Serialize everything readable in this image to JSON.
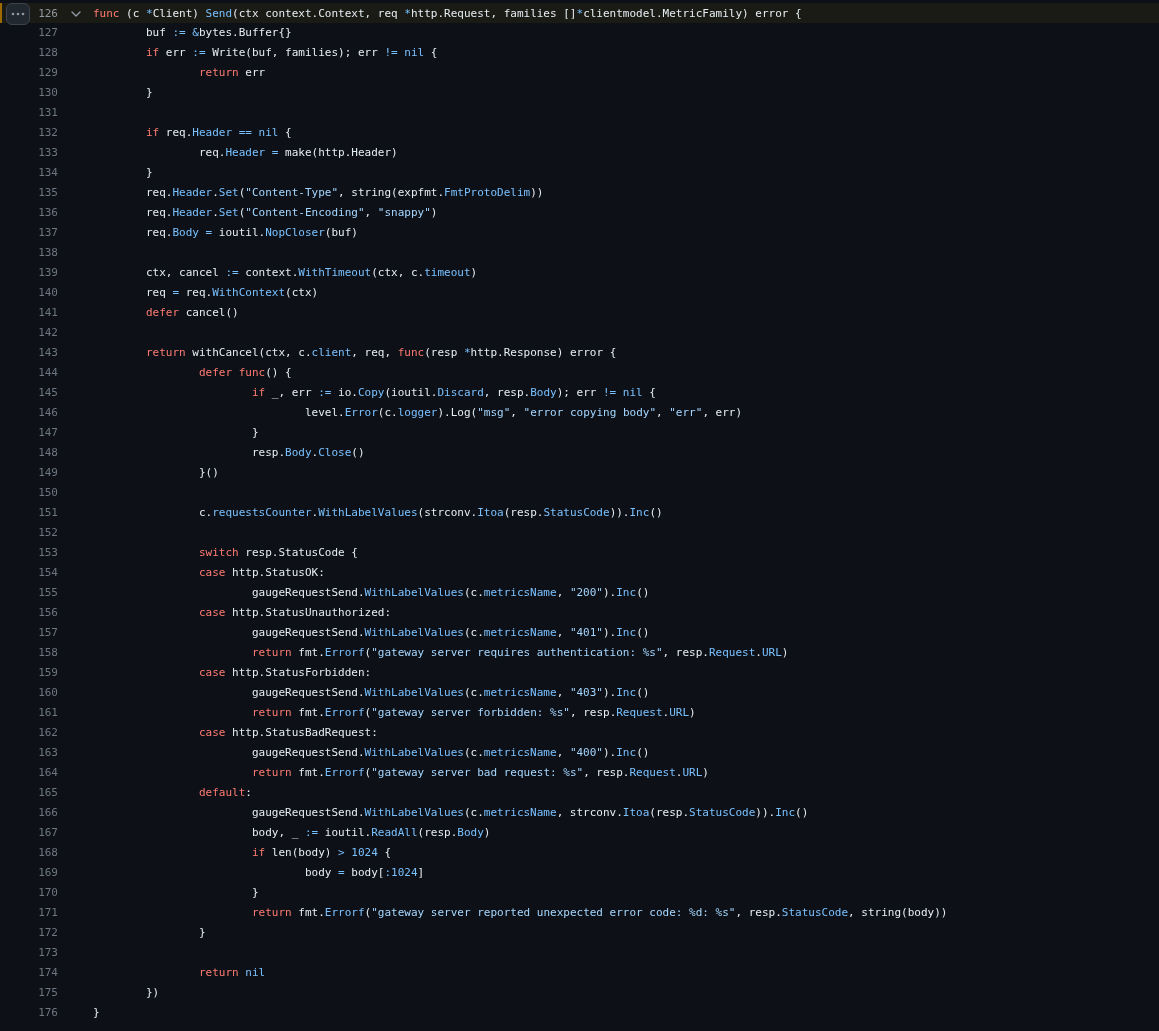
{
  "lines": [
    {
      "number": "126",
      "selected": true,
      "expanded": true,
      "code": [
        {
          "kind": "kw",
          "text": "func"
        },
        {
          "kind": "p",
          "text": " (c "
        },
        {
          "kind": "o",
          "text": "*"
        },
        {
          "kind": "p",
          "text": "Client) "
        },
        {
          "kind": "o",
          "text": "Send"
        },
        {
          "kind": "p",
          "text": "(ctx context.Context, req "
        },
        {
          "kind": "o",
          "text": "*"
        },
        {
          "kind": "p",
          "text": "http.Request, families []"
        },
        {
          "kind": "o",
          "text": "*"
        },
        {
          "kind": "p",
          "text": "clientmodel.MetricFamily) error {"
        }
      ]
    },
    {
      "number": "127",
      "selected": false,
      "code": [
        {
          "kind": "p",
          "text": "\tbuf "
        },
        {
          "kind": "o",
          "text": ":="
        },
        {
          "kind": "o",
          "text": " &"
        },
        {
          "kind": "p",
          "text": "bytes.Buffer{}"
        }
      ]
    },
    {
      "number": "128",
      "selected": false,
      "code": [
        {
          "kind": "kw",
          "text": "\tif"
        },
        {
          "kind": "p",
          "text": " err "
        },
        {
          "kind": "o",
          "text": ":="
        },
        {
          "kind": "p",
          "text": " Write(buf, families); err "
        },
        {
          "kind": "o",
          "text": "!="
        },
        {
          "kind": "o",
          "text": " nil"
        },
        {
          "kind": "p",
          "text": " {"
        }
      ]
    },
    {
      "number": "129",
      "selected": false,
      "code": [
        {
          "kind": "kw",
          "text": "\t\treturn"
        },
        {
          "kind": "p",
          "text": " err"
        }
      ]
    },
    {
      "number": "130",
      "selected": false,
      "code": [
        {
          "kind": "p",
          "text": "\t}"
        }
      ]
    },
    {
      "number": "131",
      "selected": false
    },
    {
      "number": "132",
      "selected": false,
      "code": [
        {
          "kind": "kw",
          "text": "\tif"
        },
        {
          "kind": "p",
          "text": " req."
        },
        {
          "kind": "o",
          "text": "Header"
        },
        {
          "kind": "o",
          "text": " =="
        },
        {
          "kind": "o",
          "text": " nil"
        },
        {
          "kind": "p",
          "text": " {"
        }
      ]
    },
    {
      "number": "133",
      "selected": false,
      "code": [
        {
          "kind": "p",
          "text": "\t\treq."
        },
        {
          "kind": "o",
          "text": "Header"
        },
        {
          "kind": "o",
          "text": " ="
        },
        {
          "kind": "p",
          "text": " make(http.Header)"
        }
      ]
    },
    {
      "number": "134",
      "selected": false,
      "code": [
        {
          "kind": "p",
          "text": "\t}"
        }
      ]
    },
    {
      "number": "135",
      "selected": false,
      "code": [
        {
          "kind": "p",
          "text": "\treq."
        },
        {
          "kind": "o",
          "text": "Header"
        },
        {
          "kind": "p",
          "text": "."
        },
        {
          "kind": "o",
          "text": "Set"
        },
        {
          "kind": "p",
          "text": "("
        },
        {
          "kind": "s",
          "text": "\"Content-Type\""
        },
        {
          "kind": "p",
          "text": ", string(expfmt."
        },
        {
          "kind": "o",
          "text": "FmtProtoDelim"
        },
        {
          "kind": "p",
          "text": "))"
        }
      ]
    },
    {
      "number": "136",
      "selected": false,
      "code": [
        {
          "kind": "p",
          "text": "\treq."
        },
        {
          "kind": "o",
          "text": "Header"
        },
        {
          "kind": "p",
          "text": "."
        },
        {
          "kind": "o",
          "text": "Set"
        },
        {
          "kind": "p",
          "text": "("
        },
        {
          "kind": "s",
          "text": "\"Content-Encoding\""
        },
        {
          "kind": "p",
          "text": ", "
        },
        {
          "kind": "s",
          "text": "\"snappy\""
        },
        {
          "kind": "p",
          "text": ")"
        }
      ]
    },
    {
      "number": "137",
      "selected": false,
      "code": [
        {
          "kind": "p",
          "text": "\treq."
        },
        {
          "kind": "o",
          "text": "Body"
        },
        {
          "kind": "o",
          "text": " ="
        },
        {
          "kind": "p",
          "text": " ioutil."
        },
        {
          "kind": "o",
          "text": "NopCloser"
        },
        {
          "kind": "p",
          "text": "(buf)"
        }
      ]
    },
    {
      "number": "138",
      "selected": false
    },
    {
      "number": "139",
      "selected": false,
      "code": [
        {
          "kind": "p",
          "text": "\tctx, cancel "
        },
        {
          "kind": "o",
          "text": ":="
        },
        {
          "kind": "p",
          "text": " context."
        },
        {
          "kind": "o",
          "text": "WithTimeout"
        },
        {
          "kind": "p",
          "text": "(ctx, c."
        },
        {
          "kind": "o",
          "text": "timeout"
        },
        {
          "kind": "p",
          "text": ")"
        }
      ]
    },
    {
      "number": "140",
      "selected": false,
      "code": [
        {
          "kind": "p",
          "text": "\treq "
        },
        {
          "kind": "o",
          "text": "="
        },
        {
          "kind": "p",
          "text": " req."
        },
        {
          "kind": "o",
          "text": "WithContext"
        },
        {
          "kind": "p",
          "text": "(ctx)"
        }
      ]
    },
    {
      "number": "141",
      "selected": false,
      "code": [
        {
          "kind": "kw",
          "text": "\tdefer"
        },
        {
          "kind": "p",
          "text": " cancel()"
        }
      ]
    },
    {
      "number": "142",
      "selected": false
    },
    {
      "number": "143",
      "selected": false,
      "code": [
        {
          "kind": "kw",
          "text": "\treturn"
        },
        {
          "kind": "p",
          "text": " withCancel(ctx, c."
        },
        {
          "kind": "o",
          "text": "client"
        },
        {
          "kind": "p",
          "text": ", req, "
        },
        {
          "kind": "kw",
          "text": "func"
        },
        {
          "kind": "p",
          "text": "(resp "
        },
        {
          "kind": "o",
          "text": "*"
        },
        {
          "kind": "p",
          "text": "http.Response) error {"
        }
      ]
    },
    {
      "number": "144",
      "selected": false,
      "code": [
        {
          "kind": "kw",
          "text": "\t\tdefer"
        },
        {
          "kind": "kw",
          "text": " func"
        },
        {
          "kind": "p",
          "text": "() {"
        }
      ]
    },
    {
      "number": "145",
      "selected": false,
      "code": [
        {
          "kind": "kw",
          "text": "\t\t\tif"
        },
        {
          "kind": "p",
          "text": " _, err "
        },
        {
          "kind": "o",
          "text": ":="
        },
        {
          "kind": "p",
          "text": " io."
        },
        {
          "kind": "o",
          "text": "Copy"
        },
        {
          "kind": "p",
          "text": "(ioutil."
        },
        {
          "kind": "o",
          "text": "Discard"
        },
        {
          "kind": "p",
          "text": ", resp."
        },
        {
          "kind": "o",
          "text": "Body"
        },
        {
          "kind": "p",
          "text": "); err "
        },
        {
          "kind": "o",
          "text": "!="
        },
        {
          "kind": "o",
          "text": " nil"
        },
        {
          "kind": "p",
          "text": " {"
        }
      ]
    },
    {
      "number": "146",
      "selected": false,
      "code": [
        {
          "kind": "p",
          "text": "\t\t\t\tlevel."
        },
        {
          "kind": "o",
          "text": "Error"
        },
        {
          "kind": "p",
          "text": "(c."
        },
        {
          "kind": "o",
          "text": "logger"
        },
        {
          "kind": "p",
          "text": ").Log("
        },
        {
          "kind": "s",
          "text": "\"msg\""
        },
        {
          "kind": "p",
          "text": ", "
        },
        {
          "kind": "s",
          "text": "\"error copying body\""
        },
        {
          "kind": "p",
          "text": ", "
        },
        {
          "kind": "s",
          "text": "\"err\""
        },
        {
          "kind": "p",
          "text": ", err)"
        }
      ]
    },
    {
      "number": "147",
      "selected": false,
      "code": [
        {
          "kind": "p",
          "text": "\t\t\t}"
        }
      ]
    },
    {
      "number": "148",
      "selected": false,
      "code": [
        {
          "kind": "p",
          "text": "\t\t\tresp."
        },
        {
          "kind": "o",
          "text": "Body"
        },
        {
          "kind": "p",
          "text": "."
        },
        {
          "kind": "o",
          "text": "Close"
        },
        {
          "kind": "p",
          "text": "()"
        }
      ]
    },
    {
      "number": "149",
      "selected": false,
      "code": [
        {
          "kind": "p",
          "text": "\t\t}()"
        }
      ]
    },
    {
      "number": "150",
      "selected": false
    },
    {
      "number": "151",
      "selected": false,
      "code": [
        {
          "kind": "p",
          "text": "\t\tc."
        },
        {
          "kind": "o",
          "text": "requestsCounter"
        },
        {
          "kind": "p",
          "text": "."
        },
        {
          "kind": "o",
          "text": "WithLabelValues"
        },
        {
          "kind": "p",
          "text": "(strconv."
        },
        {
          "kind": "o",
          "text": "Itoa"
        },
        {
          "kind": "p",
          "text": "(resp."
        },
        {
          "kind": "o",
          "text": "StatusCode"
        },
        {
          "kind": "p",
          "text": "))."
        },
        {
          "kind": "o",
          "text": "Inc"
        },
        {
          "kind": "p",
          "text": "()"
        }
      ]
    },
    {
      "number": "152",
      "selected": false
    },
    {
      "number": "153",
      "selected": false,
      "code": [
        {
          "kind": "kw",
          "text": "\t\tswitch"
        },
        {
          "kind": "p",
          "text": " resp.StatusCode {"
        }
      ]
    },
    {
      "number": "154",
      "selected": false,
      "code": [
        {
          "kind": "kw",
          "text": "\t\tcase"
        },
        {
          "kind": "p",
          "text": " http.StatusOK:"
        }
      ]
    },
    {
      "number": "155",
      "selected": false,
      "code": [
        {
          "kind": "p",
          "text": "\t\t\tgaugeRequestSend."
        },
        {
          "kind": "o",
          "text": "WithLabelValues"
        },
        {
          "kind": "p",
          "text": "(c."
        },
        {
          "kind": "o",
          "text": "metricsName"
        },
        {
          "kind": "p",
          "text": ", "
        },
        {
          "kind": "s",
          "text": "\"200\""
        },
        {
          "kind": "p",
          "text": ")."
        },
        {
          "kind": "o",
          "text": "Inc"
        },
        {
          "kind": "p",
          "text": "()"
        }
      ]
    },
    {
      "number": "156",
      "selected": false,
      "code": [
        {
          "kind": "kw",
          "text": "\t\tcase"
        },
        {
          "kind": "p",
          "text": " http.StatusUnauthorized:"
        }
      ]
    },
    {
      "number": "157",
      "selected": false,
      "code": [
        {
          "kind": "p",
          "text": "\t\t\tgaugeRequestSend."
        },
        {
          "kind": "o",
          "text": "WithLabelValues"
        },
        {
          "kind": "p",
          "text": "(c."
        },
        {
          "kind": "o",
          "text": "metricsName"
        },
        {
          "kind": "p",
          "text": ", "
        },
        {
          "kind": "s",
          "text": "\"401\""
        },
        {
          "kind": "p",
          "text": ")."
        },
        {
          "kind": "o",
          "text": "Inc"
        },
        {
          "kind": "p",
          "text": "()"
        }
      ]
    },
    {
      "number": "158",
      "selected": false,
      "code": [
        {
          "kind": "kw",
          "text": "\t\t\treturn"
        },
        {
          "kind": "p",
          "text": " fmt."
        },
        {
          "kind": "o",
          "text": "Errorf"
        },
        {
          "kind": "p",
          "text": "("
        },
        {
          "kind": "s",
          "text": "\"gateway server requires authentication: %s\""
        },
        {
          "kind": "p",
          "text": ", resp."
        },
        {
          "kind": "o",
          "text": "Request"
        },
        {
          "kind": "p",
          "text": "."
        },
        {
          "kind": "o",
          "text": "URL"
        },
        {
          "kind": "p",
          "text": ")"
        }
      ]
    },
    {
      "number": "159",
      "selected": false,
      "code": [
        {
          "kind": "kw",
          "text": "\t\tcase"
        },
        {
          "kind": "p",
          "text": " http.StatusForbidden:"
        }
      ]
    },
    {
      "number": "160",
      "selected": false,
      "code": [
        {
          "kind": "p",
          "text": "\t\t\tgaugeRequestSend."
        },
        {
          "kind": "o",
          "text": "WithLabelValues"
        },
        {
          "kind": "p",
          "text": "(c."
        },
        {
          "kind": "o",
          "text": "metricsName"
        },
        {
          "kind": "p",
          "text": ", "
        },
        {
          "kind": "s",
          "text": "\"403\""
        },
        {
          "kind": "p",
          "text": ")."
        },
        {
          "kind": "o",
          "text": "Inc"
        },
        {
          "kind": "p",
          "text": "()"
        }
      ]
    },
    {
      "number": "161",
      "selected": false,
      "code": [
        {
          "kind": "kw",
          "text": "\t\t\treturn"
        },
        {
          "kind": "p",
          "text": " fmt."
        },
        {
          "kind": "o",
          "text": "Errorf"
        },
        {
          "kind": "p",
          "text": "("
        },
        {
          "kind": "s",
          "text": "\"gateway server forbidden: %s\""
        },
        {
          "kind": "p",
          "text": ", resp."
        },
        {
          "kind": "o",
          "text": "Request"
        },
        {
          "kind": "p",
          "text": "."
        },
        {
          "kind": "o",
          "text": "URL"
        },
        {
          "kind": "p",
          "text": ")"
        }
      ]
    },
    {
      "number": "162",
      "selected": false,
      "code": [
        {
          "kind": "kw",
          "text": "\t\tcase"
        },
        {
          "kind": "p",
          "text": " http.StatusBadRequest:"
        }
      ]
    },
    {
      "number": "163",
      "selected": false,
      "code": [
        {
          "kind": "p",
          "text": "\t\t\tgaugeRequestSend."
        },
        {
          "kind": "o",
          "text": "WithLabelValues"
        },
        {
          "kind": "p",
          "text": "(c."
        },
        {
          "kind": "o",
          "text": "metricsName"
        },
        {
          "kind": "p",
          "text": ", "
        },
        {
          "kind": "s",
          "text": "\"400\""
        },
        {
          "kind": "p",
          "text": ")."
        },
        {
          "kind": "o",
          "text": "Inc"
        },
        {
          "kind": "p",
          "text": "()"
        }
      ]
    },
    {
      "number": "164",
      "selected": false,
      "code": [
        {
          "kind": "kw",
          "text": "\t\t\treturn"
        },
        {
          "kind": "p",
          "text": " fmt."
        },
        {
          "kind": "o",
          "text": "Errorf"
        },
        {
          "kind": "p",
          "text": "("
        },
        {
          "kind": "s",
          "text": "\"gateway server bad request: %s\""
        },
        {
          "kind": "p",
          "text": ", resp."
        },
        {
          "kind": "o",
          "text": "Request"
        },
        {
          "kind": "p",
          "text": "."
        },
        {
          "kind": "o",
          "text": "URL"
        },
        {
          "kind": "p",
          "text": ")"
        }
      ]
    },
    {
      "number": "165",
      "selected": false,
      "code": [
        {
          "kind": "kw",
          "text": "\t\tdefault"
        },
        {
          "kind": "p",
          "text": ":"
        }
      ]
    },
    {
      "number": "166",
      "selected": false,
      "code": [
        {
          "kind": "p",
          "text": "\t\t\tgaugeRequestSend."
        },
        {
          "kind": "o",
          "text": "WithLabelValues"
        },
        {
          "kind": "p",
          "text": "(c."
        },
        {
          "kind": "o",
          "text": "metricsName"
        },
        {
          "kind": "p",
          "text": ", strconv."
        },
        {
          "kind": "o",
          "text": "Itoa"
        },
        {
          "kind": "p",
          "text": "(resp."
        },
        {
          "kind": "o",
          "text": "StatusCode"
        },
        {
          "kind": "p",
          "text": "))."
        },
        {
          "kind": "o",
          "text": "Inc"
        },
        {
          "kind": "p",
          "text": "()"
        }
      ]
    },
    {
      "number": "167",
      "selected": false,
      "code": [
        {
          "kind": "p",
          "text": "\t\t\tbody, _ "
        },
        {
          "kind": "o",
          "text": ":="
        },
        {
          "kind": "p",
          "text": " ioutil."
        },
        {
          "kind": "o",
          "text": "ReadAll"
        },
        {
          "kind": "p",
          "text": "(resp."
        },
        {
          "kind": "o",
          "text": "Body"
        },
        {
          "kind": "p",
          "text": ")"
        }
      ]
    },
    {
      "number": "168",
      "selected": false,
      "code": [
        {
          "kind": "kw",
          "text": "\t\t\tif"
        },
        {
          "kind": "p",
          "text": " len(body) "
        },
        {
          "kind": "o",
          "text": ">"
        },
        {
          "kind": "o",
          "text": " 1024"
        },
        {
          "kind": "p",
          "text": " {"
        }
      ]
    },
    {
      "number": "169",
      "selected": false,
      "code": [
        {
          "kind": "p",
          "text": "\t\t\t\tbody "
        },
        {
          "kind": "o",
          "text": "="
        },
        {
          "kind": "p",
          "text": " body["
        },
        {
          "kind": "o",
          "text": ":1024"
        },
        {
          "kind": "p",
          "text": "]"
        }
      ]
    },
    {
      "number": "170",
      "selected": false,
      "code": [
        {
          "kind": "p",
          "text": "\t\t\t}"
        }
      ]
    },
    {
      "number": "171",
      "selected": false,
      "code": [
        {
          "kind": "kw",
          "text": "\t\t\treturn"
        },
        {
          "kind": "p",
          "text": " fmt."
        },
        {
          "kind": "o",
          "text": "Errorf"
        },
        {
          "kind": "p",
          "text": "("
        },
        {
          "kind": "s",
          "text": "\"gateway server reported unexpected error code: %d: %s\""
        },
        {
          "kind": "p",
          "text": ", resp."
        },
        {
          "kind": "o",
          "text": "StatusCode"
        },
        {
          "kind": "p",
          "text": ", string(body))"
        }
      ]
    },
    {
      "number": "172",
      "selected": false,
      "code": [
        {
          "kind": "p",
          "text": "\t\t}"
        }
      ]
    },
    {
      "number": "173",
      "selected": false
    },
    {
      "number": "174",
      "selected": false,
      "code": [
        {
          "kind": "kw",
          "text": "\t\treturn"
        },
        {
          "kind": "o",
          "text": " nil"
        }
      ]
    },
    {
      "number": "175",
      "selected": false,
      "code": [
        {
          "kind": "p",
          "text": "\t})"
        }
      ]
    },
    {
      "number": "176",
      "selected": false,
      "code": [
        {
          "kind": "p",
          "text": "}"
        }
      ]
    }
  ]
}
